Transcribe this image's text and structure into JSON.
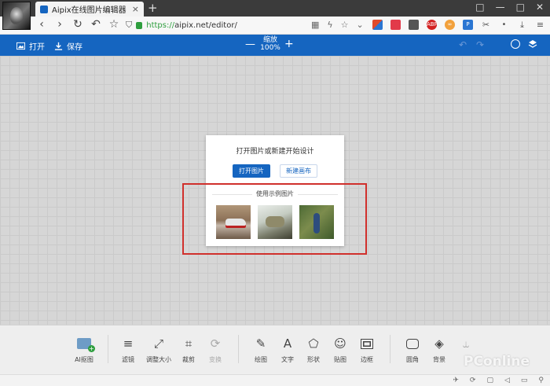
{
  "browser": {
    "tab_title": "Aipix在线图片编辑器",
    "tab_close": "×",
    "new_tab": "+",
    "window_controls": [
      "□",
      "—",
      "□",
      "✕"
    ],
    "nav": {
      "back": "‹",
      "forward": "›",
      "reload": "↻",
      "undo": "↶",
      "bookmark": "☆"
    },
    "url_scheme": "https://",
    "url_rest": "aipix.net/editor/",
    "extensions": [
      {
        "name": "ext-colorful",
        "color": "#e04b2b"
      },
      {
        "name": "ext-pocket",
        "color": "#e23a4a"
      },
      {
        "name": "ext-note",
        "color": "#555555"
      },
      {
        "name": "ext-abp",
        "color": "#d32020",
        "label": "ABP"
      },
      {
        "name": "ext-infinity",
        "color": "#f2a13c",
        "label": "∞"
      },
      {
        "name": "ext-p",
        "color": "#2b76d2",
        "label": "P"
      }
    ]
  },
  "toolbar": {
    "open_label": "打开",
    "save_label": "保存",
    "zoom_label": "缩放",
    "zoom_value": "100%",
    "zoom_minus": "—",
    "zoom_plus": "+",
    "undo": "↶",
    "redo": "↷"
  },
  "dialog": {
    "title": "打开图片或新建开始设计",
    "open_image": "打开图片",
    "new_canvas": "新建画布",
    "samples_label": "使用示例图片"
  },
  "tools": [
    {
      "id": "ai",
      "label": "AI抠图"
    },
    {
      "id": "filter",
      "label": "滤镜",
      "icon": "≡"
    },
    {
      "id": "resize",
      "label": "调整大小",
      "icon": "⤢"
    },
    {
      "id": "crop",
      "label": "裁剪",
      "icon": "⌗"
    },
    {
      "id": "transform",
      "label": "变换",
      "icon": "⟳"
    },
    {
      "id": "draw",
      "label": "绘图",
      "icon": "✎"
    },
    {
      "id": "text",
      "label": "文字",
      "icon": "A"
    },
    {
      "id": "shape",
      "label": "形状",
      "icon": "⬠"
    },
    {
      "id": "sticker",
      "label": "贴图",
      "icon": "☺"
    },
    {
      "id": "border",
      "label": "边框"
    },
    {
      "id": "corner",
      "label": "圆角"
    },
    {
      "id": "background",
      "label": "背景",
      "icon": "◈"
    },
    {
      "id": "merge",
      "label": "",
      "icon": "⥿"
    }
  ],
  "watermark": "PConline",
  "status_icons": [
    "✈",
    "⟳",
    "▢",
    "◁",
    "▭",
    "⚲"
  ]
}
